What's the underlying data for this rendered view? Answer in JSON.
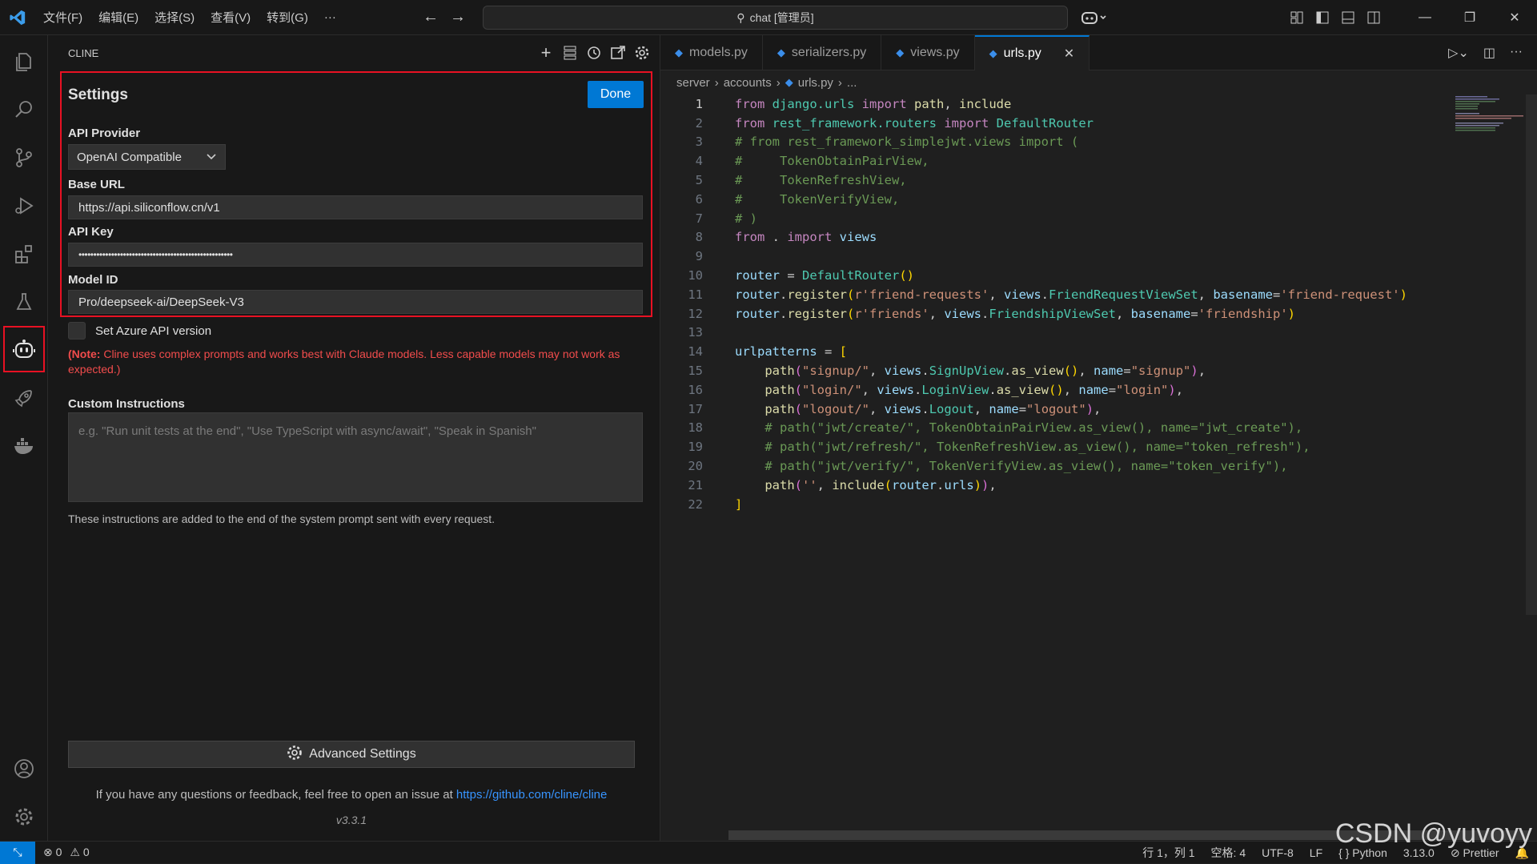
{
  "titlebar": {
    "menus": [
      "文件(F)",
      "编辑(E)",
      "选择(S)",
      "查看(V)",
      "转到(G)",
      "···"
    ],
    "search_text": "chat [管理员]"
  },
  "sidebar": {
    "title": "CLINE",
    "settings_title": "Settings",
    "done_label": "Done",
    "api_provider_label": "API Provider",
    "api_provider_value": "OpenAI Compatible",
    "base_url_label": "Base URL",
    "base_url_value": "https://api.siliconflow.cn/v1",
    "api_key_label": "API Key",
    "api_key_value": "••••••••••••••••••••••••••••••••••••••••••••••••••••",
    "model_id_label": "Model ID",
    "model_id_value": "Pro/deepseek-ai/DeepSeek-V3",
    "azure_label": "Set Azure API version",
    "note_bold": "(Note:",
    "note_text": " Cline uses complex prompts and works best with Claude models. Less capable models may not work as expected.)",
    "custom_instructions_label": "Custom Instructions",
    "custom_instructions_placeholder": "e.g. \"Run unit tests at the end\", \"Use TypeScript with async/await\", \"Speak in Spanish\"",
    "hint": "These instructions are added to the end of the system prompt sent with every request.",
    "advanced_label": "Advanced Settings",
    "feedback_text": "If you have any questions or feedback, feel free to open an issue at ",
    "feedback_link": "https://github.com/cline/cline",
    "version": "v3.3.1"
  },
  "editor": {
    "tabs": [
      "models.py",
      "serializers.py",
      "views.py",
      "urls.py"
    ],
    "breadcrumb": [
      "server",
      "accounts",
      "urls.py",
      "..."
    ],
    "line_numbers": [
      "1",
      "2",
      "3",
      "4",
      "5",
      "6",
      "7",
      "8",
      "9",
      "10",
      "11",
      "12",
      "13",
      "14",
      "15",
      "16",
      "17",
      "18",
      "19",
      "20",
      "21",
      "22"
    ]
  },
  "statusbar": {
    "errors": "0",
    "warnings": "0",
    "position": "行 1，列 1",
    "spaces": "空格: 4",
    "encoding": "UTF-8",
    "eol": "LF",
    "language": "Python",
    "python_version": "3.13.0",
    "prettier": "Prettier"
  },
  "watermark": "CSDN @yuvoyy",
  "colors": {
    "accent": "#0078d4",
    "highlight_border": "#e81123",
    "note": "#f14c4c"
  }
}
